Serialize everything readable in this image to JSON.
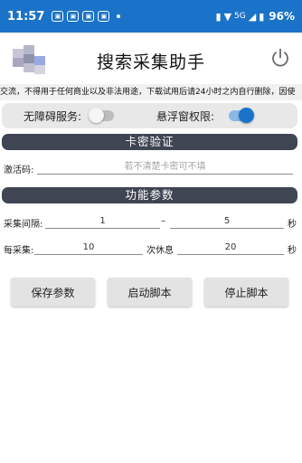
{
  "status_bar": {
    "time": "11:57",
    "notification_icons": [
      "app-notification-icon",
      "app-notification-icon",
      "app-notification-icon",
      "app-notification-icon"
    ],
    "signal_label": "5G",
    "battery": "96%"
  },
  "header": {
    "title": "搜索采集助手"
  },
  "notice": {
    "text": "交流，不得用于任何商业以及非法用途，下载试用后请24小时之内自行删除，因使"
  },
  "permissions": {
    "accessibility_label": "无障碍服务:",
    "accessibility_enabled": false,
    "overlay_label": "悬浮窗权限:",
    "overlay_enabled": true
  },
  "card_section": {
    "title": "卡密验证",
    "activation_label": "激活码:",
    "activation_value": "",
    "activation_placeholder": "若不清楚卡密可不填"
  },
  "params_section": {
    "title": "功能参数",
    "interval_label": "采集间隔:",
    "interval_min": "1",
    "interval_sep": "–",
    "interval_max": "5",
    "interval_unit": "秒",
    "per_collect_label": "每采集:",
    "per_collect_value": "10",
    "rest_label": "次休息",
    "rest_value": "20",
    "rest_unit": "秒"
  },
  "buttons": {
    "save": "保存参数",
    "start": "启动脚本",
    "stop": "停止脚本"
  },
  "colors": {
    "status_bar": "#1a73c8",
    "section_header": "#404553",
    "accent": "#1a73c8"
  }
}
